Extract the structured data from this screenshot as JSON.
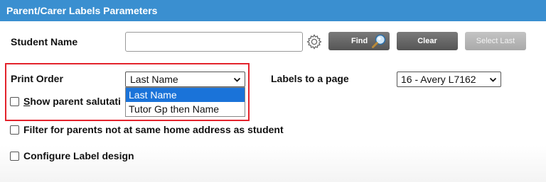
{
  "window": {
    "title": "Parent/Carer Labels Parameters"
  },
  "student": {
    "label": "Student Name",
    "value": "",
    "find_label": "Find",
    "clear_label": "Clear",
    "select_last_label": "Select Last"
  },
  "print_order": {
    "label": "Print Order",
    "selected": "Last Name",
    "options": [
      "Last Name",
      "Tutor Gp then Name"
    ],
    "highlighted_option": "Last Name"
  },
  "labels_page": {
    "label": "Labels to a page",
    "selected": "16 - Avery L7162"
  },
  "options": {
    "show_salutation_first": "S",
    "show_salutation_rest": "how parent salutati",
    "filter_parents": "Filter for parents not at same home address as student",
    "configure_label": "Configure Label design"
  },
  "colors": {
    "titlebar": "#3a8fd0",
    "highlight": "#e3232c",
    "selected_option": "#1a73d9"
  },
  "icons": [
    "gear-icon",
    "magnifier-icon",
    "chevron-down-icon"
  ]
}
